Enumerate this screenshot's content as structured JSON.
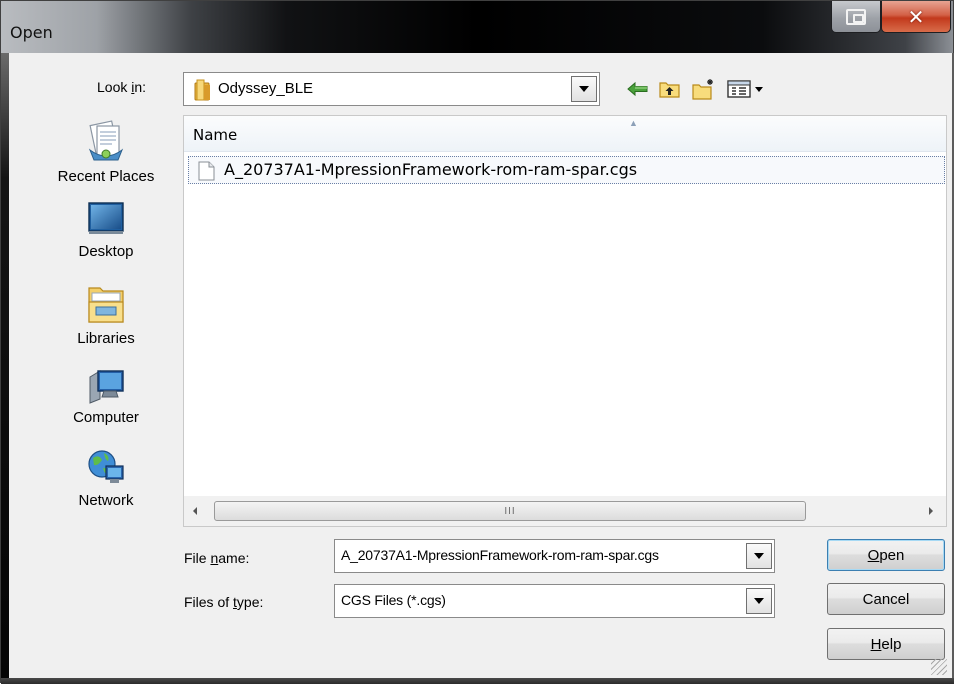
{
  "window": {
    "title": "Open"
  },
  "lookin": {
    "label_prefix": "Look ",
    "label_accel": "i",
    "label_suffix": "n:",
    "value": "Odyssey_BLE"
  },
  "toolbar": {
    "icons": [
      "back-arrow-icon",
      "up-folder-icon",
      "new-folder-icon",
      "view-menu-icon"
    ]
  },
  "places": [
    {
      "label": "Recent Places",
      "icon": "recent-places-icon"
    },
    {
      "label": "Desktop",
      "icon": "desktop-icon"
    },
    {
      "label": "Libraries",
      "icon": "libraries-icon"
    },
    {
      "label": "Computer",
      "icon": "computer-icon"
    },
    {
      "label": "Network",
      "icon": "network-icon"
    }
  ],
  "filelist": {
    "column_header": "Name",
    "files": [
      {
        "name": "A_20737A1-MpressionFramework-rom-ram-spar.cgs"
      }
    ]
  },
  "filename": {
    "label_prefix": "File ",
    "label_accel": "n",
    "label_suffix": "ame:",
    "value": "A_20737A1-MpressionFramework-rom-ram-spar.cgs"
  },
  "filetype": {
    "label_prefix": "Files of ",
    "label_accel": "t",
    "label_suffix": "ype:",
    "value": "CGS Files (*.cgs)"
  },
  "buttons": {
    "open": {
      "accel": "O",
      "rest": "pen"
    },
    "cancel": {
      "label": "Cancel"
    },
    "help": {
      "accel": "H",
      "rest": "elp"
    }
  },
  "colors": {
    "accent_focus": "#3c7fb1",
    "close_button": "#c2391c",
    "list_header_bg": "#eef3f8"
  }
}
